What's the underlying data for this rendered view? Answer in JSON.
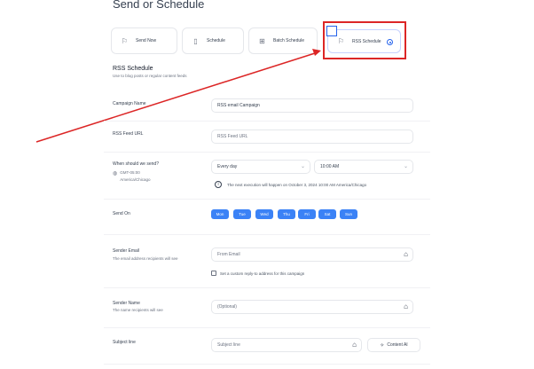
{
  "page": {
    "title": "Send or Schedule"
  },
  "tabs": [
    {
      "label": "Send Now",
      "icon": "flag-icon"
    },
    {
      "label": "Schedule",
      "icon": "calendar-icon"
    },
    {
      "label": "Batch Schedule",
      "icon": "layers-icon"
    },
    {
      "label": "RSS Schedule",
      "icon": "rss-icon",
      "selected": true
    }
  ],
  "section": {
    "title": "RSS Schedule",
    "description": "Use to blog posts or regular content feeds"
  },
  "form": {
    "campaign_name": {
      "label": "Campaign Name",
      "value": "RSS email Campaign"
    },
    "rss_feed": {
      "label": "RSS Feed URL",
      "placeholder": "RSS Feed URL"
    },
    "when": {
      "label": "When should we send?",
      "timezone_offset": "GMT-05:00",
      "timezone_name": "America/Chicago",
      "frequency": "Every day",
      "time": "10:00 AM",
      "next_execution": "The next execution will happen on October 3, 2024 10:00 AM America/Chicago"
    },
    "send_on": {
      "label": "Send On",
      "days": [
        "Mon",
        "Tue",
        "Wed",
        "Thu",
        "Fri",
        "Sat",
        "Sun"
      ]
    },
    "sender_email": {
      "label": "Sender Email",
      "description": "The email address recipients will see",
      "placeholder": "From Email",
      "reply_to_label": "Set a custom reply-to address for this campaign"
    },
    "sender_name": {
      "label": "Sender Name",
      "description": "The name recipients will see",
      "placeholder": "(Optional)"
    },
    "subject": {
      "label": "Subject line",
      "placeholder": "Subject line",
      "ai_button": "Content AI"
    }
  },
  "colors": {
    "accent": "#3b82f6",
    "annotation": "#dc2626"
  }
}
